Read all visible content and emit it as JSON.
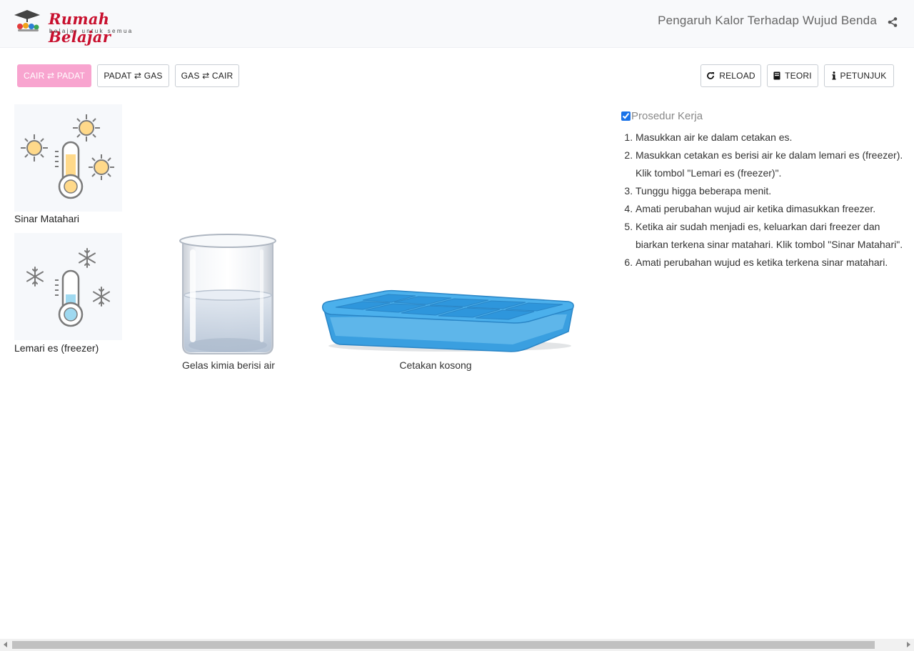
{
  "header": {
    "logo_text": "Rumah Belajar",
    "logo_tagline": "belajar untuk semua",
    "title": "Pengaruh Kalor Terhadap Wujud Benda",
    "share_icon": "share-icon"
  },
  "tabs": [
    {
      "label": "CAIR ⇄ PADAT",
      "active": true
    },
    {
      "label": "PADAT ⇄ GAS",
      "active": false
    },
    {
      "label": "GAS ⇄ CAIR",
      "active": false
    }
  ],
  "actions": {
    "reload": "RELOAD",
    "teori": "TEORI",
    "petunjuk": "PETUNJUK"
  },
  "tools": {
    "sun": "Sinar Matahari",
    "freezer": "Lemari es (freezer)"
  },
  "objects": {
    "beaker": "Gelas kimia berisi air",
    "tray": "Cetakan kosong"
  },
  "procedure": {
    "title": "Prosedur Kerja",
    "checked": true,
    "steps": [
      "Masukkan air ke dalam cetakan es.",
      "Masukkan cetakan es berisi air ke dalam lemari es (freezer). Klik tombol \"Lemari es (freezer)\".",
      "Tunggu higga beberapa menit.",
      "Amati perubahan wujud air ketika dimasukkan freezer.",
      "Ketika air sudah menjadi es, keluarkan dari freezer dan biarkan terkena sinar matahari. Klik tombol \"Sinar Matahari\".",
      "Amati perubahan wujud es ketika terkena sinar matahari."
    ]
  },
  "colors": {
    "accent_active": "#f8a4cf",
    "brand_red": "#c8102e",
    "sun_yellow": "#ffd98a",
    "cold_blue": "#9fd9f0",
    "tray_blue": "#3a9fe0"
  }
}
